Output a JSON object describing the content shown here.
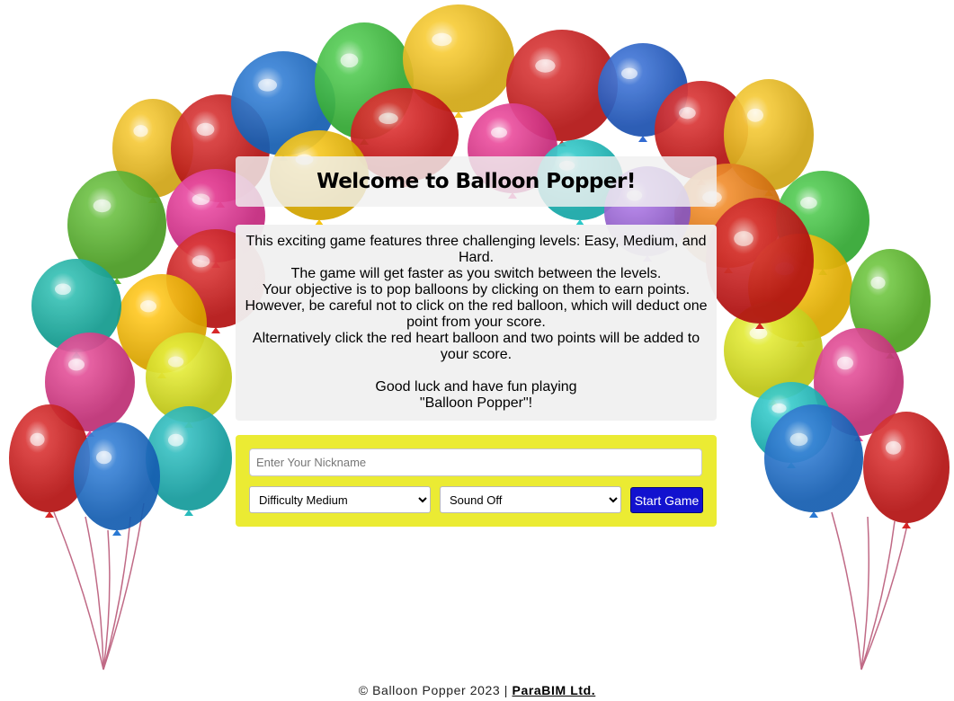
{
  "title": "Welcome to Balloon Popper!",
  "description": {
    "lines": [
      "This exciting game features three challenging levels: Easy, Medium, and Hard.",
      "The game will get faster as you switch between the levels.",
      "Your objective is to pop balloons by clicking on them to earn points.",
      "However, be careful not to click on the red balloon, which will deduct one point from your score.",
      "Alternatively click the red heart balloon and two points will be added to your score."
    ],
    "closing_1": "Good luck and have fun playing",
    "closing_2": "\"Balloon Popper\"!"
  },
  "form": {
    "nickname_placeholder": "Enter Your Nickname",
    "nickname_value": "",
    "difficulty_selected": "Difficulty Medium",
    "sound_selected": "Sound Off",
    "start_label": "Start Game"
  },
  "footer": {
    "text": "© Balloon Popper 2023 | ",
    "link": "ParaBIM Ltd."
  },
  "colors": {
    "form_background": "#ebeb33",
    "start_button": "#1212cf",
    "panel_background": "#f0f0f0"
  }
}
